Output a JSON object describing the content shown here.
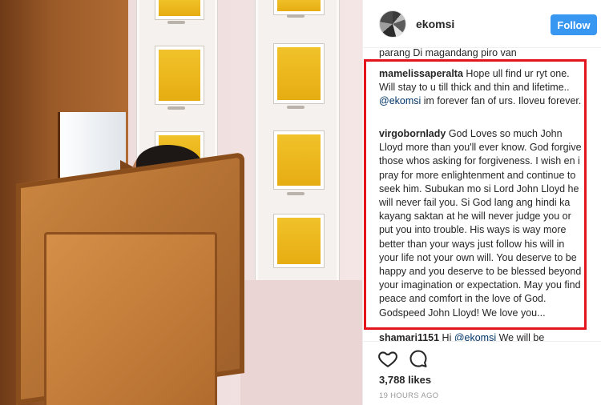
{
  "post": {
    "username": "ekomsi",
    "follow_label": "Follow",
    "likes": "3,788 likes",
    "time_ago": "19 HOURS AGO"
  },
  "comments": {
    "cut_top_text": "parang Di magandang piro van",
    "items": [
      {
        "user": "mamelissaperalta",
        "text_before": " Hope ull find ur ryt one. Will stay to u till thick and thin and lifetime.. ",
        "mention": "@ekomsi",
        "text_after": " im forever fan of urs. Iloveu forever."
      },
      {
        "user": "virgobornlady",
        "text_before": " God Loves so much John Lloyd more than you'll ever know. God forgive those whos asking for forgiveness. I wish en i pray for more enlightenment and continue to seek him. Subukan mo si Lord John Lloyd he will never fail you. Si God lang ang hindi ka kayang saktan at he will never judge you or put you into trouble. His ways is way more better than your ways just follow his will in your life not your own will. You deserve to be happy and you deserve to be blessed beyond your imagination or expectation. May you find peace and comfort in the love of God. Godspeed John Lloyd! We love you...",
        "mention": "",
        "text_after": ""
      }
    ],
    "cut_bottom": {
      "user": "shamari1151",
      "text_before": " Hi ",
      "mention": "@ekomsi",
      "text_after": " We will be"
    }
  },
  "icons": {
    "like": "heart-icon",
    "comment": "comment-bubble-icon",
    "avatar": "avatar"
  },
  "colors": {
    "follow_button": "#3897f0",
    "highlight_border": "#e3141c",
    "mention": "#003569"
  }
}
